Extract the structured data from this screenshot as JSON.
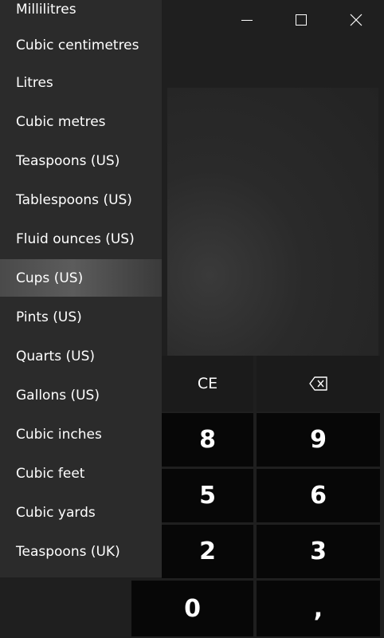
{
  "window_controls": {
    "minimize_icon": "minimize-icon",
    "maximize_icon": "maximize-icon",
    "close_icon": "close-icon"
  },
  "units_list": {
    "partial_top_item": "Millilitres",
    "selected": "Cups (US)",
    "items": [
      "Cubic centimetres",
      "Litres",
      "Cubic metres",
      "Teaspoons (US)",
      "Tablespoons (US)",
      "Fluid ounces (US)",
      "Cups (US)",
      "Pints (US)",
      "Quarts (US)",
      "Gallons (US)",
      "Cubic inches",
      "Cubic feet",
      "Cubic yards",
      "Teaspoons (UK)"
    ]
  },
  "keypad": {
    "ce": "CE",
    "backspace_icon": "backspace-icon",
    "k8": "8",
    "k9": "9",
    "k5": "5",
    "k6": "6",
    "k2": "2",
    "k3": "3",
    "k0": "0",
    "decimal": ","
  },
  "colors": {
    "background": "#1f1f1f",
    "list_background": "#2b2b2b",
    "selected_item": "#4f4f4f",
    "number_key": "#070707",
    "function_key": "#1b1b1b"
  }
}
